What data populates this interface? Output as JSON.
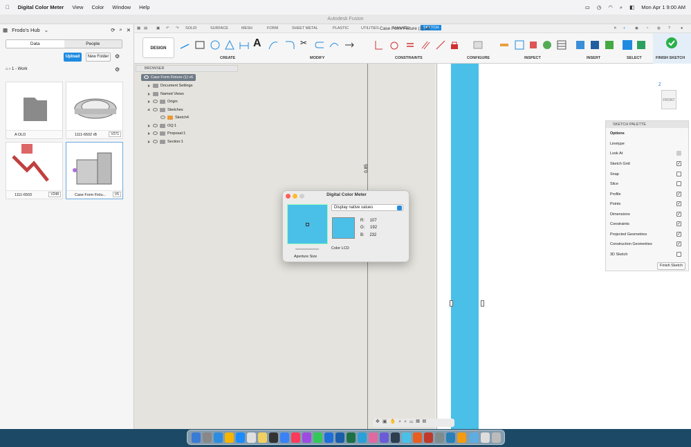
{
  "menubar": {
    "app_name": "Digital Color Meter",
    "menus": [
      "View",
      "Color",
      "Window",
      "Help"
    ],
    "datetime": "Mon Apr 1  9:00 AM"
  },
  "window": {
    "title": "Autodesk Fusion"
  },
  "data_panel": {
    "hub_name": "Frodo's Hub",
    "tabs": [
      "Data",
      "People"
    ],
    "upload_label": "Upload",
    "new_folder_label": "New Folder",
    "breadcrumb": "1 - Work",
    "items": [
      {
        "name": "A OLD",
        "version": ""
      },
      {
        "name": "1111-6502 rB",
        "version": "V271"
      },
      {
        "name": "1111-6503",
        "version": "V248"
      },
      {
        "name": "Case Form Fixtu...",
        "version": "V6"
      }
    ]
  },
  "doc_tab": {
    "title": "Case Form Fixture (1) v6*"
  },
  "toolbar": {
    "workspace": "DESIGN",
    "tabs": [
      "SOLID",
      "SURFACE",
      "MESH",
      "FORM",
      "SHEET METAL",
      "PLASTIC",
      "UTILITIES",
      "MANAGE",
      "SKETCH"
    ],
    "active_tab": "SKETCH",
    "groups": [
      "CREATE",
      "MODIFY",
      "CONSTRAINTS",
      "CONFIGURE",
      "INSPECT",
      "INSERT",
      "SELECT",
      "FINISH SKETCH"
    ]
  },
  "browser": {
    "header": "BROWSER",
    "rows": [
      {
        "label": "Case Form Fixture (1) v6"
      },
      {
        "label": "Document Settings"
      },
      {
        "label": "Named Views"
      },
      {
        "label": "Origin"
      },
      {
        "label": "Sketches"
      },
      {
        "label": "Sketch4"
      },
      {
        "label": "OQ:1"
      },
      {
        "label": "Proposal:1"
      },
      {
        "label": "Section:1"
      }
    ]
  },
  "canvas": {
    "dimension": "0.85",
    "viewcube": "FRONT",
    "axis": "Z"
  },
  "sketch_palette": {
    "title": "SKETCH PALETTE",
    "section": "Options",
    "options": [
      {
        "label": "Linetype",
        "checked": null
      },
      {
        "label": "Look At",
        "checked": null
      },
      {
        "label": "Sketch Grid",
        "checked": true
      },
      {
        "label": "Snap",
        "checked": false
      },
      {
        "label": "Slice",
        "checked": false
      },
      {
        "label": "Profile",
        "checked": true
      },
      {
        "label": "Points",
        "checked": true
      },
      {
        "label": "Dimensions",
        "checked": true
      },
      {
        "label": "Constraints",
        "checked": true
      },
      {
        "label": "Projected Geometries",
        "checked": true
      },
      {
        "label": "Construction Geometries",
        "checked": true
      },
      {
        "label": "3D Sketch",
        "checked": false
      }
    ],
    "finish_label": "Finish Sketch"
  },
  "color_meter": {
    "title": "Digital Color Meter",
    "mode": "Display native values",
    "r_label": "R:",
    "r": "107",
    "g_label": "G:",
    "g": "192",
    "b_label": "B:",
    "b": "232",
    "aperture_label": "Aperture Size",
    "profile": "Color LCD",
    "sample_color": "#4ac0e8"
  }
}
